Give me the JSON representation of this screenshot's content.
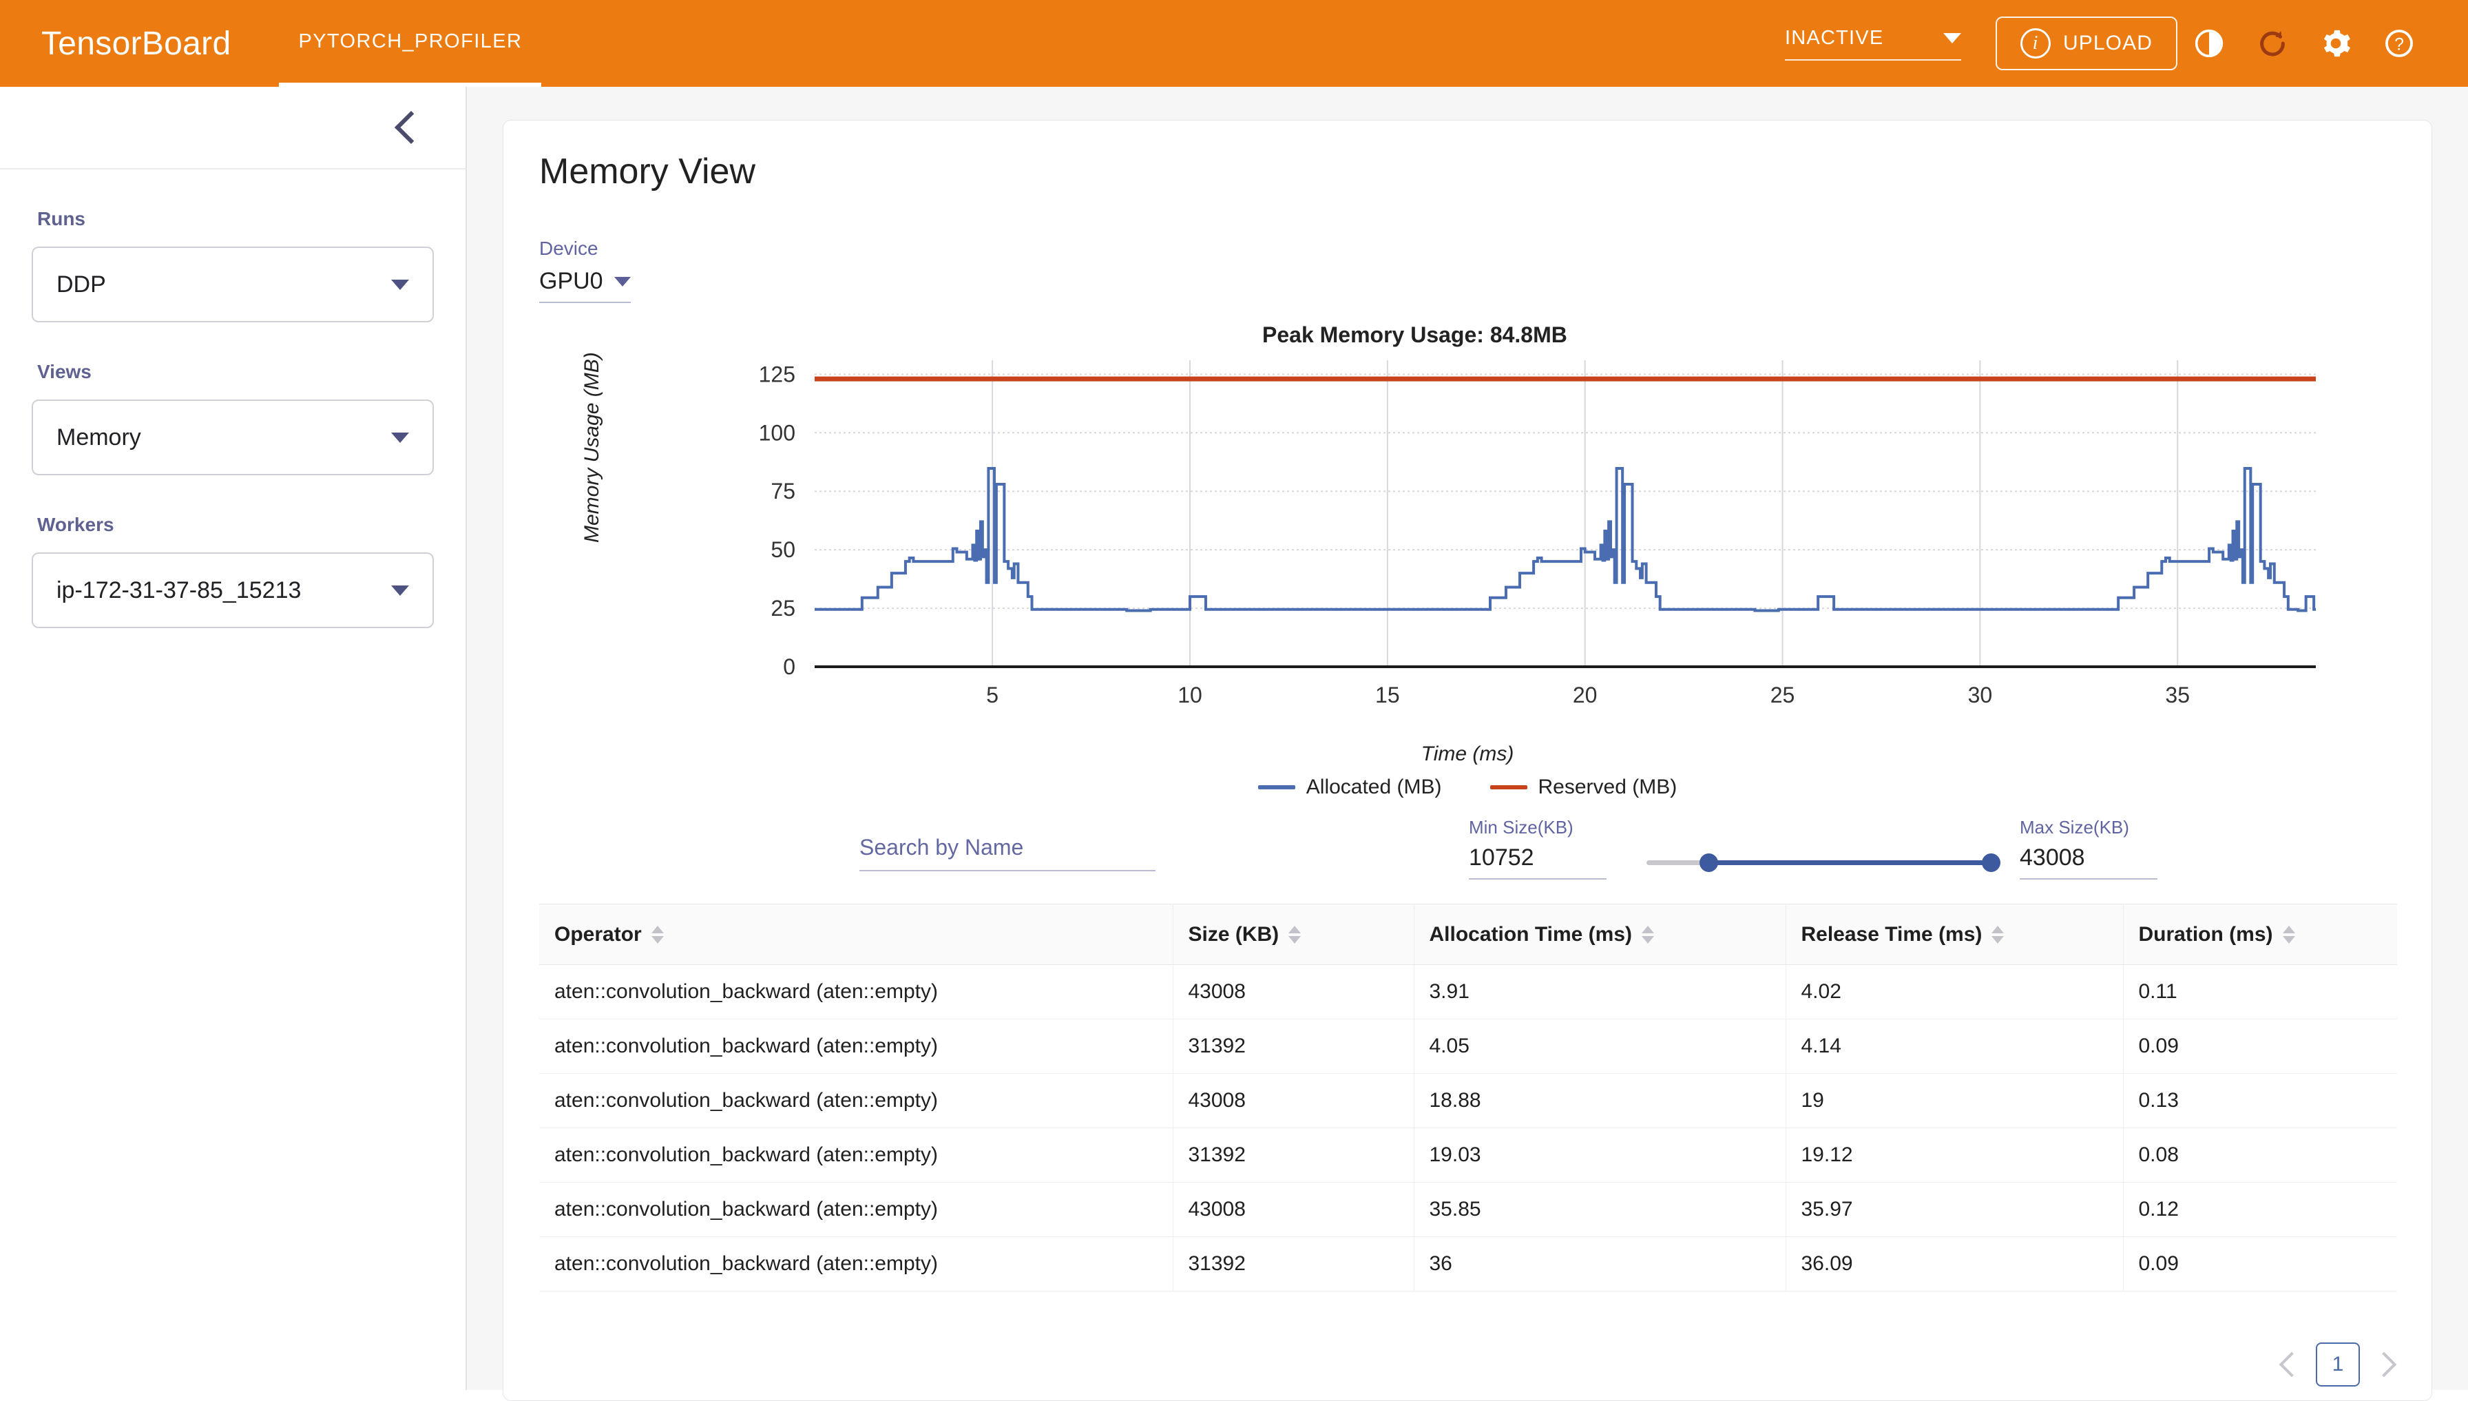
{
  "topbar": {
    "brand": "TensorBoard",
    "tab": "PYTORCH_PROFILER",
    "status": "INACTIVE",
    "upload_label": "UPLOAD",
    "accent": "#ec7c12",
    "icons": [
      "brightness-icon",
      "refresh-icon",
      "gear-icon",
      "help-icon"
    ]
  },
  "sidebar": {
    "runs_label": "Runs",
    "runs_value": "DDP",
    "views_label": "Views",
    "views_value": "Memory",
    "workers_label": "Workers",
    "workers_value": "ip-172-31-37-85_15213"
  },
  "main": {
    "title": "Memory View",
    "device_label": "Device",
    "device_value": "GPU0"
  },
  "filters": {
    "search_placeholder": "Search by Name",
    "search_value": "",
    "min_label": "Min Size(KB)",
    "min_value": "10752",
    "max_label": "Max Size(KB)",
    "max_value": "43008",
    "slider_min_pct": 18,
    "slider_max_pct": 100
  },
  "table": {
    "headers": [
      "Operator",
      "Size (KB)",
      "Allocation Time (ms)",
      "Release Time (ms)",
      "Duration (ms)"
    ],
    "rows": [
      [
        "aten::convolution_backward (aten::empty)",
        "43008",
        "3.91",
        "4.02",
        "0.11"
      ],
      [
        "aten::convolution_backward (aten::empty)",
        "31392",
        "4.05",
        "4.14",
        "0.09"
      ],
      [
        "aten::convolution_backward (aten::empty)",
        "43008",
        "18.88",
        "19",
        "0.13"
      ],
      [
        "aten::convolution_backward (aten::empty)",
        "31392",
        "19.03",
        "19.12",
        "0.08"
      ],
      [
        "aten::convolution_backward (aten::empty)",
        "43008",
        "35.85",
        "35.97",
        "0.12"
      ],
      [
        "aten::convolution_backward (aten::empty)",
        "31392",
        "36",
        "36.09",
        "0.09"
      ]
    ]
  },
  "pagination": {
    "current_page": "1"
  },
  "chart_data": {
    "type": "line",
    "title": "Peak Memory Usage: 84.8MB",
    "xlabel": "Time (ms)",
    "ylabel": "Memory Usage (MB)",
    "xlim": [
      0.5,
      38.5
    ],
    "ylim": [
      0,
      131
    ],
    "xticks": [
      5,
      10,
      15,
      20,
      25,
      30,
      35
    ],
    "yticks": [
      0,
      25,
      50,
      75,
      100,
      125
    ],
    "grid": true,
    "legend_position": "bottom",
    "series": [
      {
        "name": "Allocated (MB)",
        "color": "#4a6cb0",
        "step": true,
        "points": [
          [
            0.5,
            24.5
          ],
          [
            1.6,
            24.5
          ],
          [
            1.7,
            29.5
          ],
          [
            2.0,
            29.5
          ],
          [
            2.1,
            34.0
          ],
          [
            2.35,
            34.0
          ],
          [
            2.45,
            40.0
          ],
          [
            2.7,
            40.0
          ],
          [
            2.8,
            45.0
          ],
          [
            2.9,
            46.5
          ],
          [
            3.0,
            45.0
          ],
          [
            3.9,
            45.0
          ],
          [
            4.0,
            50.5
          ],
          [
            4.1,
            49.0
          ],
          [
            4.25,
            49.0
          ],
          [
            4.35,
            46.0
          ],
          [
            4.45,
            46.0
          ],
          [
            4.5,
            52.0
          ],
          [
            4.55,
            45.5
          ],
          [
            4.6,
            58.0
          ],
          [
            4.65,
            46.0
          ],
          [
            4.7,
            62.0
          ],
          [
            4.75,
            47.0
          ],
          [
            4.8,
            50.0
          ],
          [
            4.85,
            36.0
          ],
          [
            4.9,
            84.8
          ],
          [
            5.0,
            84.8
          ],
          [
            5.05,
            36.0
          ],
          [
            5.1,
            78.0
          ],
          [
            5.2,
            78.0
          ],
          [
            5.3,
            45.0
          ],
          [
            5.4,
            42.0
          ],
          [
            5.5,
            38.0
          ],
          [
            5.55,
            44.0
          ],
          [
            5.6,
            44.0
          ],
          [
            5.65,
            36.0
          ],
          [
            5.8,
            36.0
          ],
          [
            5.9,
            30.0
          ],
          [
            6.0,
            24.5
          ],
          [
            8.3,
            24.5
          ],
          [
            8.4,
            24.0
          ],
          [
            8.9,
            24.0
          ],
          [
            9.0,
            24.5
          ],
          [
            9.9,
            24.5
          ],
          [
            10.0,
            30.0
          ],
          [
            10.3,
            30.0
          ],
          [
            10.4,
            24.5
          ],
          [
            17.0,
            24.5
          ],
          [
            17.5,
            24.5
          ],
          [
            17.6,
            29.5
          ],
          [
            17.9,
            29.5
          ],
          [
            18.0,
            34.0
          ],
          [
            18.25,
            34.0
          ],
          [
            18.35,
            40.0
          ],
          [
            18.6,
            40.0
          ],
          [
            18.7,
            45.0
          ],
          [
            18.8,
            46.5
          ],
          [
            18.9,
            45.0
          ],
          [
            19.8,
            45.0
          ],
          [
            19.9,
            50.5
          ],
          [
            20.0,
            49.0
          ],
          [
            20.15,
            49.0
          ],
          [
            20.25,
            46.0
          ],
          [
            20.35,
            46.0
          ],
          [
            20.4,
            52.0
          ],
          [
            20.45,
            45.5
          ],
          [
            20.5,
            58.0
          ],
          [
            20.55,
            46.0
          ],
          [
            20.6,
            62.0
          ],
          [
            20.65,
            47.0
          ],
          [
            20.7,
            50.0
          ],
          [
            20.75,
            36.0
          ],
          [
            20.8,
            84.8
          ],
          [
            20.9,
            84.8
          ],
          [
            20.95,
            36.0
          ],
          [
            21.0,
            78.0
          ],
          [
            21.1,
            78.0
          ],
          [
            21.2,
            45.0
          ],
          [
            21.3,
            42.0
          ],
          [
            21.4,
            38.0
          ],
          [
            21.45,
            44.0
          ],
          [
            21.5,
            44.0
          ],
          [
            21.55,
            36.0
          ],
          [
            21.7,
            36.0
          ],
          [
            21.8,
            30.0
          ],
          [
            21.9,
            24.5
          ],
          [
            24.2,
            24.5
          ],
          [
            24.3,
            24.0
          ],
          [
            24.8,
            24.0
          ],
          [
            24.9,
            24.5
          ],
          [
            25.8,
            24.5
          ],
          [
            25.9,
            30.0
          ],
          [
            26.2,
            30.0
          ],
          [
            26.3,
            24.5
          ],
          [
            33.0,
            24.5
          ],
          [
            33.4,
            24.5
          ],
          [
            33.5,
            29.5
          ],
          [
            33.8,
            29.5
          ],
          [
            33.9,
            34.0
          ],
          [
            34.15,
            34.0
          ],
          [
            34.25,
            40.0
          ],
          [
            34.5,
            40.0
          ],
          [
            34.6,
            45.0
          ],
          [
            34.7,
            46.5
          ],
          [
            34.8,
            45.0
          ],
          [
            35.7,
            45.0
          ],
          [
            35.8,
            50.5
          ],
          [
            35.9,
            49.0
          ],
          [
            36.05,
            49.0
          ],
          [
            36.15,
            46.0
          ],
          [
            36.25,
            46.0
          ],
          [
            36.3,
            52.0
          ],
          [
            36.35,
            45.5
          ],
          [
            36.4,
            58.0
          ],
          [
            36.45,
            46.0
          ],
          [
            36.5,
            62.0
          ],
          [
            36.55,
            47.0
          ],
          [
            36.6,
            50.0
          ],
          [
            36.65,
            36.0
          ],
          [
            36.7,
            84.8
          ],
          [
            36.8,
            84.8
          ],
          [
            36.85,
            36.0
          ],
          [
            36.9,
            78.0
          ],
          [
            37.0,
            78.0
          ],
          [
            37.1,
            45.0
          ],
          [
            37.2,
            42.0
          ],
          [
            37.3,
            38.0
          ],
          [
            37.35,
            44.0
          ],
          [
            37.4,
            44.0
          ],
          [
            37.45,
            36.0
          ],
          [
            37.6,
            36.0
          ],
          [
            37.7,
            30.0
          ],
          [
            37.8,
            24.5
          ],
          [
            38.0,
            24.5
          ],
          [
            38.05,
            24.0
          ],
          [
            38.2,
            24.0
          ],
          [
            38.25,
            30.0
          ],
          [
            38.4,
            30.0
          ],
          [
            38.45,
            24.5
          ],
          [
            38.5,
            24.5
          ]
        ]
      },
      {
        "name": "Reserved (MB)",
        "color": "#c8431b",
        "step": false,
        "constant": 123.0,
        "points": [
          [
            0.5,
            123.0
          ],
          [
            38.5,
            123.0
          ]
        ]
      }
    ]
  }
}
